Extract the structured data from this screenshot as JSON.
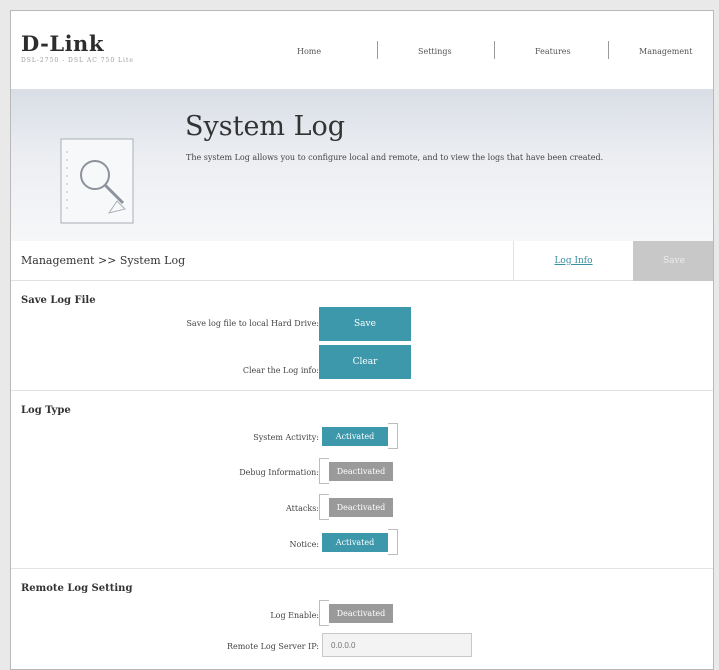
{
  "brand": {
    "logo": "D-Link",
    "model": "DSL-2750 - DSL AC 750 Lite"
  },
  "nav": {
    "home": "Home",
    "settings": "Settings",
    "features": "Features",
    "management": "Management"
  },
  "banner": {
    "title": "System Log",
    "description": "The system Log allows you to configure local and remote, and to view the logs that have been created."
  },
  "breadcrumb": "Management >> System Log",
  "actions": {
    "log_info": "Log Info",
    "save": "Save"
  },
  "save_log_file": {
    "title": "Save Log File",
    "save_label": "Save log file to local Hard Drive:",
    "save_button": "Save",
    "clear_label": "Clear the Log info:",
    "clear_button": "Clear"
  },
  "log_type": {
    "title": "Log Type",
    "items": [
      {
        "label": "System Activity:",
        "state": "Activated",
        "on": true
      },
      {
        "label": "Debug Information:",
        "state": "Deactivated",
        "on": false
      },
      {
        "label": "Attacks:",
        "state": "Deactivated",
        "on": false
      },
      {
        "label": "Notice:",
        "state": "Activated",
        "on": true
      }
    ]
  },
  "remote_log": {
    "title": "Remote Log Setting",
    "enable_label": "Log Enable:",
    "enable_state": "Deactivated",
    "enable_on": false,
    "server_label": "Remote Log Server IP:",
    "server_placeholder": "0.0.0.0"
  },
  "colors": {
    "accent": "#3d98ab",
    "inactive": "#9a9a9a",
    "save_disabled": "#c8c8c8"
  }
}
